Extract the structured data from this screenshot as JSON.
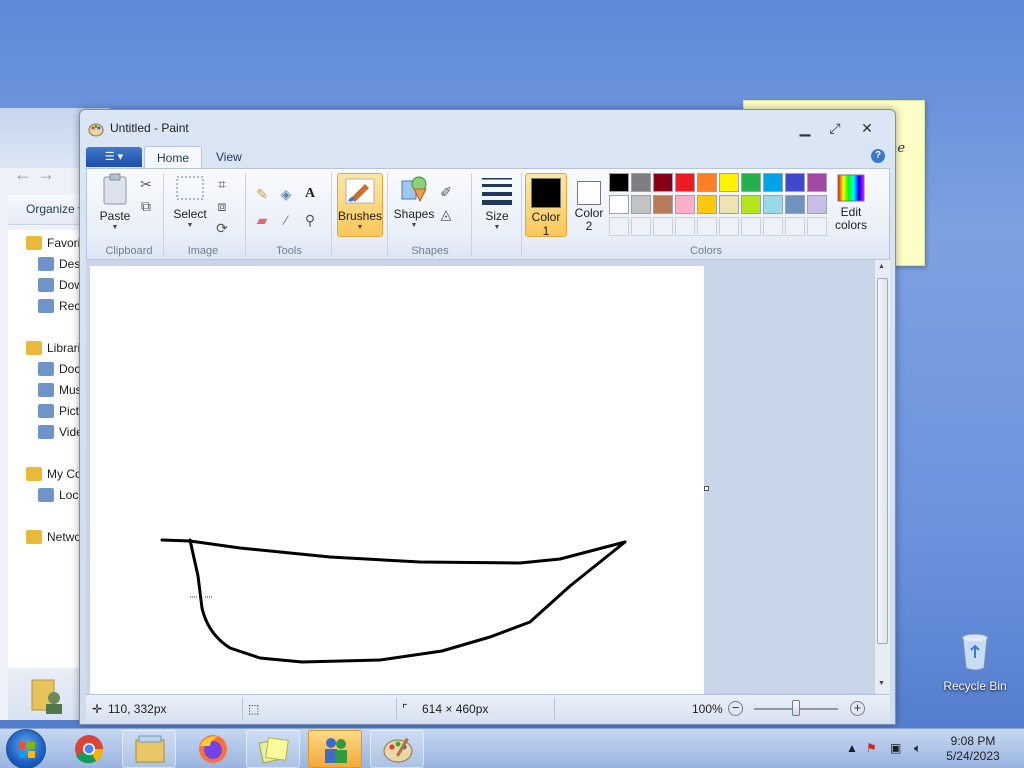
{
  "explorer": {
    "toolbar_label": "Organize",
    "nav_items": [
      {
        "label": "Favorit",
        "type": "header"
      },
      {
        "label": "Desk",
        "type": "sub"
      },
      {
        "label": "Dow",
        "type": "sub"
      },
      {
        "label": "Recer",
        "type": "sub"
      },
      {
        "label": "Librarie",
        "type": "header"
      },
      {
        "label": "Docu",
        "type": "sub"
      },
      {
        "label": "Musi",
        "type": "sub"
      },
      {
        "label": "Pictu",
        "type": "sub"
      },
      {
        "label": "Video",
        "type": "sub"
      },
      {
        "label": "My Co",
        "type": "header"
      },
      {
        "label": "Local",
        "type": "sub"
      },
      {
        "label": "Networ",
        "type": "header"
      }
    ]
  },
  "sticky_note": {
    "text": "ne"
  },
  "paint": {
    "title": "Untitled - Paint",
    "tabs": [
      "Home",
      "View"
    ],
    "groups": {
      "clipboard": "Clipboard",
      "image": "Image",
      "tools": "Tools",
      "shapes": "Shapes",
      "colors": "Colors"
    },
    "buttons": {
      "paste": "Paste",
      "select": "Select",
      "brushes": "Brushes",
      "shapes": "Shapes",
      "size": "Size",
      "color1": "Color 1",
      "color2": "Color 2",
      "edit_colors": "Edit colors"
    },
    "colors": {
      "color1": "#000000",
      "color2": "#ffffff",
      "palette_row1": [
        "#000000",
        "#7f7f7f",
        "#880015",
        "#ed1c24",
        "#ff7f27",
        "#fff200",
        "#22b14c",
        "#00a2e8",
        "#3f48cc",
        "#a349a4"
      ],
      "palette_row2": [
        "#ffffff",
        "#c3c3c3",
        "#b97a57",
        "#ffaec9",
        "#ffc90e",
        "#efe4b0",
        "#b5e61d",
        "#99d9ea",
        "#7092be",
        "#c8bfe7"
      ]
    },
    "status": {
      "cursor": "110, 332px",
      "image_size": "614 × 460px",
      "zoom": "100%"
    }
  },
  "desktop": {
    "recycle_bin": "Recycle Bin"
  },
  "taskbar": {
    "time": "9:08 PM",
    "date": "5/24/2023"
  }
}
